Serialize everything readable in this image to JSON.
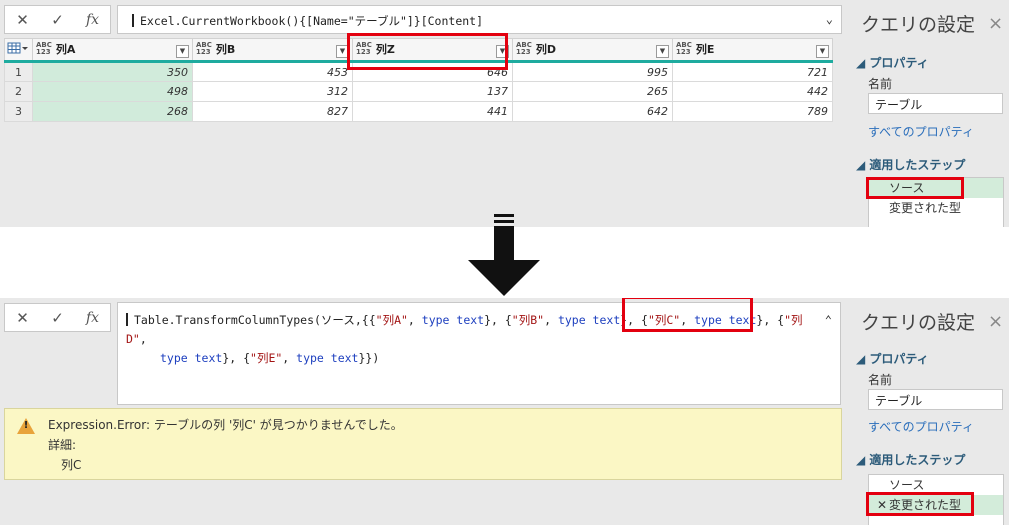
{
  "top": {
    "formula_bar": {
      "buttons": [
        "✕",
        "✓",
        "fx"
      ],
      "formula": "Excel.CurrentWorkbook(){[Name=\"テーブル\"]}[Content]",
      "toggle": "⌄"
    },
    "grid": {
      "type_badge_top": "ABC",
      "type_badge_bottom": "123",
      "columns": [
        "列A",
        "列B",
        "列Z",
        "列D",
        "列E"
      ],
      "rows": [
        {
          "num": "1",
          "cells": [
            "350",
            "453",
            "646",
            "995",
            "721"
          ]
        },
        {
          "num": "2",
          "cells": [
            "498",
            "312",
            "137",
            "265",
            "442"
          ]
        },
        {
          "num": "3",
          "cells": [
            "268",
            "827",
            "441",
            "642",
            "789"
          ]
        }
      ]
    },
    "query_settings": {
      "title": "クエリの設定",
      "close": "×",
      "properties_header": "◢ プロパティ",
      "name_label": "名前",
      "name_value": "テーブル",
      "all_properties": "すべてのプロパティ",
      "steps_header": "◢ 適用したステップ",
      "steps": [
        "ソース",
        "変更された型"
      ]
    }
  },
  "bottom": {
    "formula_bar": {
      "buttons": [
        "✕",
        "✓",
        "fx"
      ],
      "line1": {
        "a": "Table.TransformColumnTypes(ソース,{{",
        "s1": "\"列A\"",
        "t1": ", ",
        "k1": "type text",
        "t2": "}, {",
        "s2": "\"列B\"",
        "t3": ", ",
        "k2": "type text",
        "t4": "}, {",
        "s3": "\"列C\"",
        "t5": ", ",
        "k3": "type text",
        "t6": "}, {",
        "s4": "\"列D\"",
        "t7": ","
      },
      "line2": {
        "k4": "type text",
        "t8": "}, {",
        "s5": "\"列E\"",
        "t9": ", ",
        "k5": "type text",
        "t10": "}})"
      },
      "toggle": "⌃"
    },
    "error": {
      "message": "Expression.Error: テーブルの列 '列C' が見つかりませんでした。",
      "details_label": "詳細:",
      "details_value": "列C"
    },
    "query_settings": {
      "title": "クエリの設定",
      "close": "×",
      "properties_header": "◢ プロパティ",
      "name_label": "名前",
      "name_value": "テーブル",
      "all_properties": "すべてのプロパティ",
      "steps_header": "◢ 適用したステップ",
      "steps": [
        "ソース",
        "変更された型"
      ],
      "step_error_icon": "✕"
    }
  },
  "colors": {
    "panel_bg": "#e9e9e9",
    "header_accent": "#1eab9f",
    "first_column_fill": "#d1ebdb",
    "highlight_red": "#e3000f",
    "error_bg": "#fbf7c5",
    "link": "#2a6ebb",
    "keyword": "#1d3fbf",
    "string": "#a31515"
  },
  "icons": {
    "table_menu": "table-grid-icon",
    "warning": "warning-triangle-icon",
    "down_arrow": "down-arrow-icon"
  }
}
